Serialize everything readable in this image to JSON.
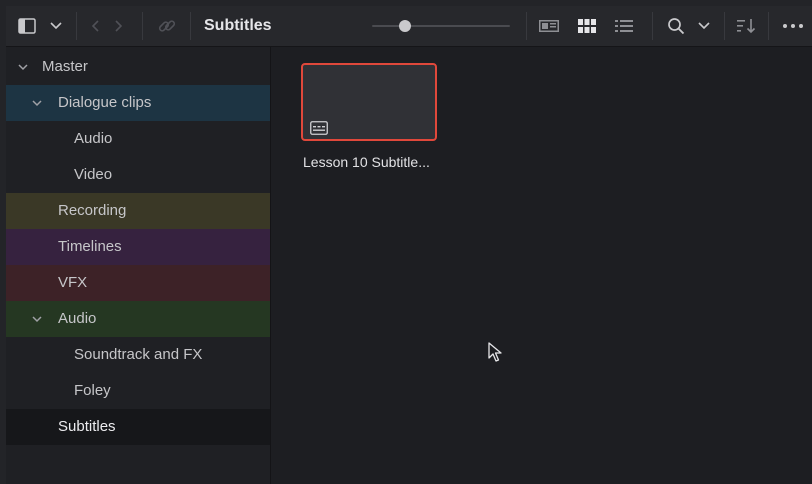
{
  "toolbar": {
    "title": "Subtitles",
    "zoom_level": 0.25,
    "icons": [
      "panel-toggle-icon",
      "chevron-down-icon",
      "back-icon",
      "forward-icon",
      "link-icon",
      "metadata-view-icon",
      "thumbnail-view-icon",
      "list-view-icon",
      "search-icon",
      "chevron-down-icon",
      "sort-icon",
      "more-icon"
    ]
  },
  "sidebar": {
    "items": [
      {
        "label": "Master",
        "expanded": true,
        "color": "#1f2024"
      },
      {
        "label": "Dialogue clips",
        "expanded": true,
        "color": "#1d3443"
      },
      {
        "label": "Audio",
        "color": "#1f2024"
      },
      {
        "label": "Video",
        "color": "#1f2024"
      },
      {
        "label": "Recording",
        "color": "#3a3826"
      },
      {
        "label": "Timelines",
        "color": "#36223f"
      },
      {
        "label": "VFX",
        "color": "#3d2227"
      },
      {
        "label": "Audio",
        "expanded": true,
        "color": "#253722"
      },
      {
        "label": "Soundtrack and FX",
        "color": "#1f2024"
      },
      {
        "label": "Foley",
        "color": "#1f2024"
      },
      {
        "label": "Subtitles",
        "selected": true,
        "color": "#16171a"
      }
    ]
  },
  "content": {
    "clip": {
      "label": "Lesson 10 Subtitle...",
      "selected": true,
      "icon": "subtitle-icon"
    }
  },
  "colors": {
    "accent_selection": "#e0483b",
    "background": "#1d1e22",
    "toolbar": "#27282c"
  }
}
